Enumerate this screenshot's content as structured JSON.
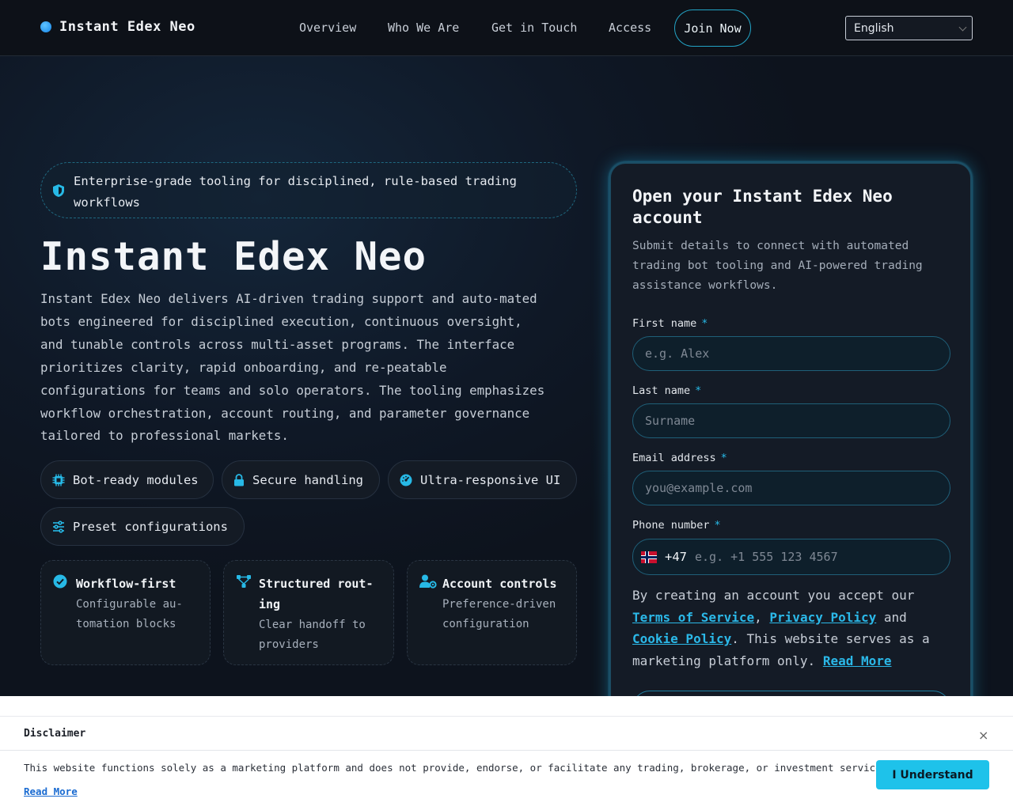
{
  "nav": {
    "brand": "Instant Edex Neo",
    "links": [
      "Overview",
      "Who We Are",
      "Get in Touch",
      "Access"
    ],
    "join": "Join Now",
    "language": "English"
  },
  "hero": {
    "pill": "Enterprise-grade tooling for disciplined, rule-based trading workflows",
    "title": "Instant Edex Neo",
    "description": "Instant Edex Neo delivers AI-driven trading support and auto-mated bots engineered for disciplined execution, continuous oversight, and tunable controls across multi-asset programs. The interface prioritizes clarity, rapid onboarding, and re-peatable configurations for teams and solo operators. The tooling emphasizes workflow orchestration, account routing, and parameter governance tailored to professional markets.",
    "chips": [
      "Bot-ready modules",
      "Secure handling",
      "Ultra-responsive UI",
      "Preset configurations"
    ],
    "cards": [
      {
        "title": "Workflow-first",
        "sub": "Configurable au-tomation blocks"
      },
      {
        "title": "Structured rout-ing",
        "sub": "Clear handoff to providers"
      },
      {
        "title": "Account controls",
        "sub": "Preference-driven configuration"
      }
    ]
  },
  "form": {
    "title": "Open your Instant Edex Neo account",
    "subtitle": "Submit details to connect with automated trading bot tooling and AI-powered trading assistance workflows.",
    "required_mark": "*",
    "fields": {
      "first_name": {
        "label": "First name",
        "placeholder": "e.g. Alex"
      },
      "last_name": {
        "label": "Last name",
        "placeholder": "Surname"
      },
      "email": {
        "label": "Email address",
        "placeholder": "you@example.com"
      },
      "phone": {
        "label": "Phone number",
        "code": "+47",
        "placeholder": "e.g. +1 555 123 4567"
      }
    },
    "consent": {
      "prefix": "By creating an account you accept our",
      "terms": "Terms of Service",
      "sep": ",",
      "privacy": "Privacy Policy",
      "and": "and",
      "cookie": "Cookie Policy",
      "suffix": ". This website serves as a marketing platform only.",
      "read_more": "Read More"
    }
  },
  "disclaimer": {
    "title": "Disclaimer",
    "close": "×",
    "text": "This website functions solely as a marketing platform and does not provide, endorse, or facilitate any trading, brokerage, or investment services.",
    "read_more": "Read More",
    "button": "I Understand"
  },
  "colors": {
    "accent": "#1ec2ea",
    "background": "#0e1420",
    "panel": "#141b26"
  }
}
